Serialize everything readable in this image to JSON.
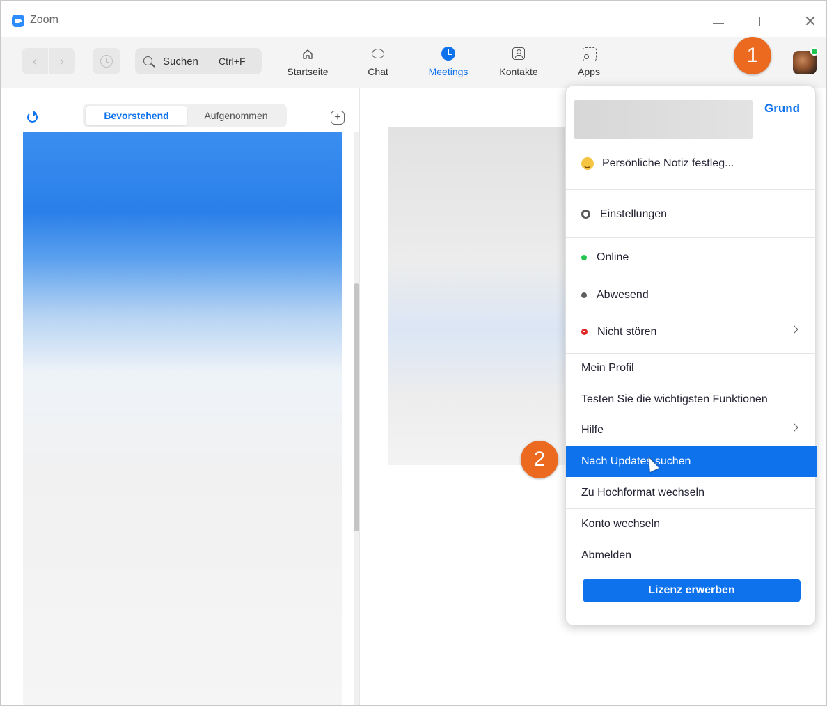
{
  "window": {
    "title": "Zoom"
  },
  "toolbar": {
    "search_label": "Suchen",
    "search_shortcut": "Ctrl+F",
    "tabs": [
      {
        "label": "Startseite",
        "icon": "home-icon"
      },
      {
        "label": "Chat",
        "icon": "chat-icon"
      },
      {
        "label": "Meetings",
        "icon": "clock-icon",
        "active": true
      },
      {
        "label": "Kontakte",
        "icon": "contact-icon"
      },
      {
        "label": "Apps",
        "icon": "apps-icon"
      }
    ]
  },
  "annotations": {
    "step1": "1",
    "step2": "2"
  },
  "meetings_panel": {
    "tab_upcoming": "Bevorstehend",
    "tab_recorded": "Aufgenommen",
    "add_symbol": "+"
  },
  "profile_menu": {
    "plan": "Grund",
    "personal_note": "Persönliche Notiz festleg...",
    "settings": "Einstellungen",
    "status_online": "Online",
    "status_away": "Abwesend",
    "status_dnd": "Nicht stören",
    "my_profile": "Mein Profil",
    "test_features": "Testen Sie die wichtigsten Funktionen",
    "help": "Hilfe",
    "check_updates": "Nach Updates suchen",
    "portrait_mode": "Zu Hochformat wechseln",
    "switch_account": "Konto wechseln",
    "sign_out": "Abmelden",
    "buy_license": "Lizenz erwerben"
  },
  "colors": {
    "accent": "#0e72ed",
    "annotation_orange": "#ec6a1f",
    "online_green": "#23c552",
    "dnd_red": "#e02828"
  }
}
